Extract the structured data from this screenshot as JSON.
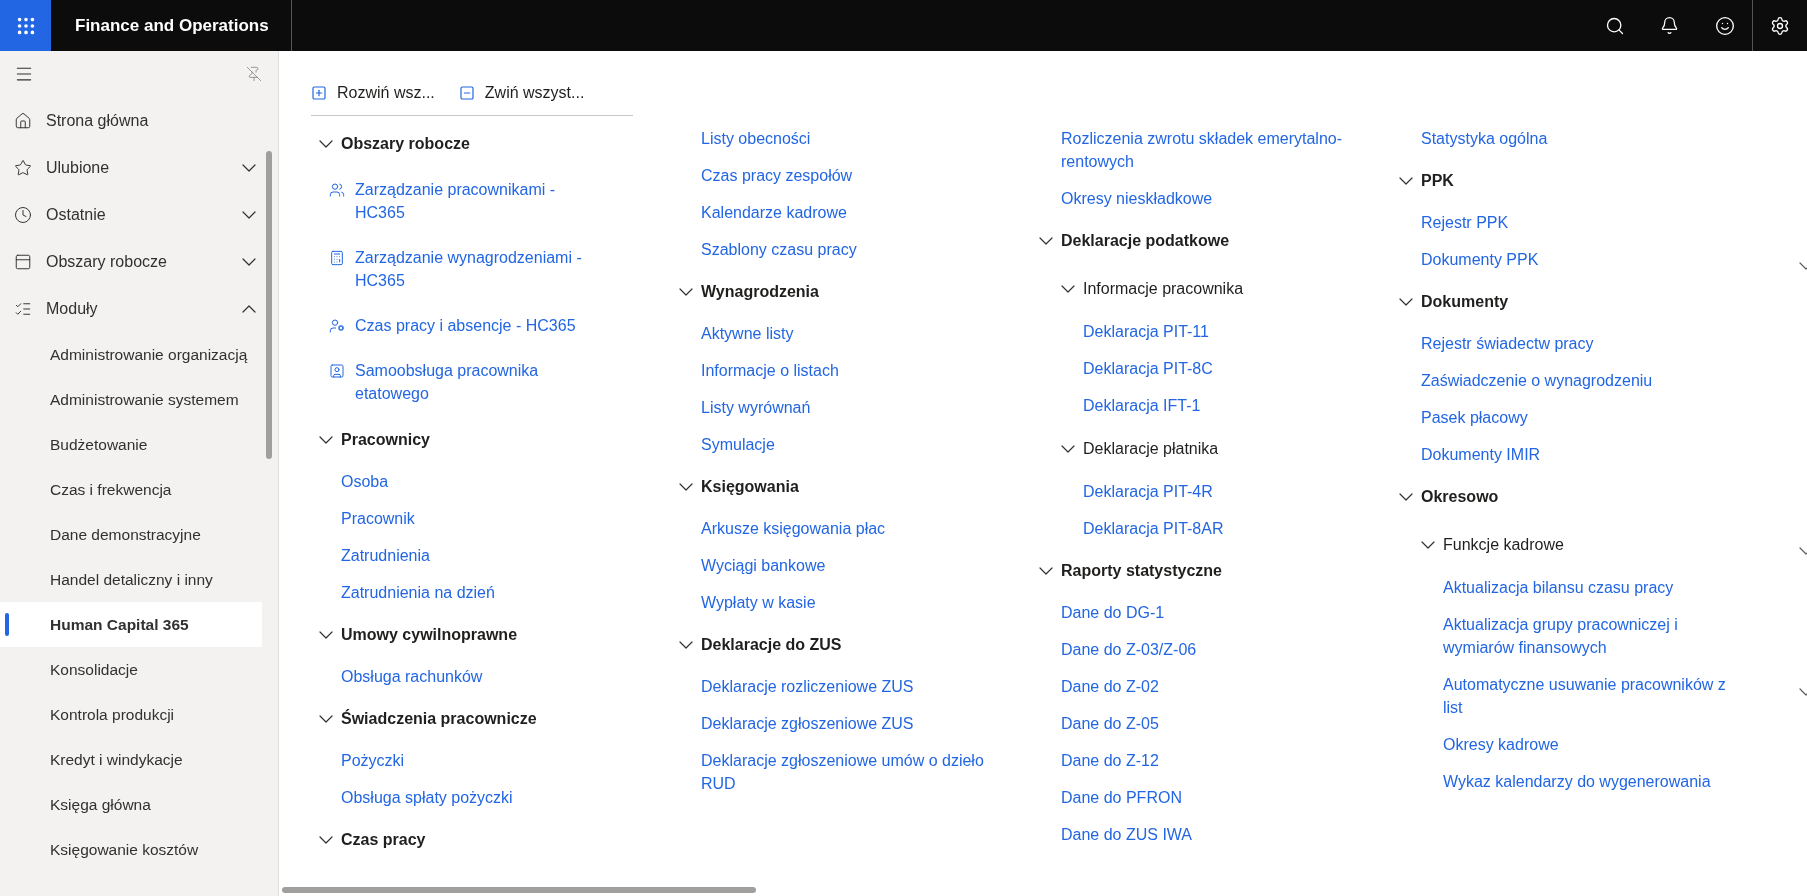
{
  "app": {
    "title": "Finance and Operations"
  },
  "nav": {
    "items": [
      {
        "kind": "link",
        "label": "Strona główna"
      },
      {
        "kind": "section",
        "label": "Ulubione",
        "expanded": false
      },
      {
        "kind": "section",
        "label": "Ostatnie",
        "expanded": false
      },
      {
        "kind": "section",
        "label": "Obszary robocze",
        "expanded": false
      },
      {
        "kind": "section",
        "label": "Moduły",
        "expanded": true
      }
    ],
    "modules": [
      {
        "label": "Administrowanie organizacją",
        "selected": false
      },
      {
        "label": "Administrowanie systemem",
        "selected": false
      },
      {
        "label": "Budżetowanie",
        "selected": false
      },
      {
        "label": "Czas i frekwencja",
        "selected": false
      },
      {
        "label": "Dane demonstracyjne",
        "selected": false
      },
      {
        "label": "Handel detaliczny i inny",
        "selected": false
      },
      {
        "label": "Human Capital 365",
        "selected": true
      },
      {
        "label": "Konsolidacje",
        "selected": false
      },
      {
        "label": "Kontrola produkcji",
        "selected": false
      },
      {
        "label": "Kredyt i windykacje",
        "selected": false
      },
      {
        "label": "Księga główna",
        "selected": false
      },
      {
        "label": "Księgowanie kosztów",
        "selected": false
      }
    ]
  },
  "toolbar": [
    {
      "kind": "expand",
      "label": "Rozwiń wsz..."
    },
    {
      "kind": "collapse",
      "label": "Zwiń wszyst..."
    }
  ],
  "columns": [
    [
      {
        "kind": "group",
        "label": "Obszary robocze",
        "expanded": true,
        "children": [
          {
            "kind": "workspace",
            "label": "Zarządzanie pracownikami - HC365"
          },
          {
            "kind": "workspace",
            "label": "Zarządzanie wynagrodzeniami - HC365"
          },
          {
            "kind": "workspace",
            "label": "Czas pracy i absencje - HC365"
          },
          {
            "kind": "workspace",
            "label": "Samoobsługa pracownika etatowego"
          }
        ]
      },
      {
        "kind": "group",
        "label": "Pracownicy",
        "expanded": true,
        "children": [
          {
            "kind": "link",
            "label": "Osoba"
          },
          {
            "kind": "link",
            "label": "Pracownik"
          },
          {
            "kind": "link",
            "label": "Zatrudnienia"
          },
          {
            "kind": "link",
            "label": "Zatrudnienia na dzień"
          }
        ]
      },
      {
        "kind": "group",
        "label": "Umowy cywilnoprawne",
        "expanded": true,
        "children": [
          {
            "kind": "link",
            "label": "Obsługa rachunków"
          }
        ]
      },
      {
        "kind": "group",
        "label": "Świadczenia pracownicze",
        "expanded": true,
        "children": [
          {
            "kind": "link",
            "label": "Pożyczki"
          },
          {
            "kind": "link",
            "label": "Obsługa spłaty pożyczki"
          }
        ]
      },
      {
        "kind": "group",
        "label": "Czas pracy",
        "expanded": true
      }
    ],
    [
      {
        "kind": "continued",
        "children": [
          {
            "kind": "link",
            "label": "Listy obecności"
          },
          {
            "kind": "link",
            "label": "Czas pracy zespołów"
          },
          {
            "kind": "link",
            "label": "Kalendarze kadrowe"
          },
          {
            "kind": "link",
            "label": "Szablony czasu pracy"
          }
        ]
      },
      {
        "kind": "group",
        "label": "Wynagrodzenia",
        "expanded": true,
        "children": [
          {
            "kind": "link",
            "label": "Aktywne listy"
          },
          {
            "kind": "link",
            "label": "Informacje o listach"
          },
          {
            "kind": "link",
            "label": "Listy wyrównań"
          },
          {
            "kind": "link",
            "label": "Symulacje"
          }
        ]
      },
      {
        "kind": "group",
        "label": "Księgowania",
        "expanded": true,
        "children": [
          {
            "kind": "link",
            "label": "Arkusze księgowania płac"
          },
          {
            "kind": "link",
            "label": "Wyciągi bankowe"
          },
          {
            "kind": "link",
            "label": "Wypłaty w kasie"
          }
        ]
      },
      {
        "kind": "group",
        "label": "Deklaracje do ZUS",
        "expanded": true,
        "children": [
          {
            "kind": "link",
            "label": "Deklaracje rozliczeniowe ZUS"
          },
          {
            "kind": "link",
            "label": "Deklaracje zgłoszeniowe ZUS"
          },
          {
            "kind": "link",
            "label": "Deklaracje zgłoszeniowe umów o dzieło RUD"
          }
        ]
      }
    ],
    [
      {
        "kind": "continued",
        "children": [
          {
            "kind": "link",
            "label": "Rozliczenia zwrotu składek emerytalno-rentowych"
          },
          {
            "kind": "link",
            "label": "Okresy nieskładkowe"
          }
        ]
      },
      {
        "kind": "group",
        "label": "Deklaracje podatkowe",
        "expanded": true,
        "children": [
          {
            "kind": "group",
            "label": "Informacje pracownika",
            "expanded": true,
            "children": [
              {
                "kind": "link",
                "label": "Deklaracja PIT-11"
              },
              {
                "kind": "link",
                "label": "Deklaracja PIT-8C"
              },
              {
                "kind": "link",
                "label": "Deklaracja IFT-1"
              }
            ]
          },
          {
            "kind": "group",
            "label": "Deklaracje płatnika",
            "expanded": true,
            "children": [
              {
                "kind": "link",
                "label": "Deklaracja PIT-4R"
              },
              {
                "kind": "link",
                "label": "Deklaracja PIT-8AR"
              }
            ]
          }
        ]
      },
      {
        "kind": "group",
        "label": "Raporty statystyczne",
        "expanded": true,
        "children": [
          {
            "kind": "link",
            "label": "Dane do DG-1"
          },
          {
            "kind": "link",
            "label": "Dane do Z-03/Z-06"
          },
          {
            "kind": "link",
            "label": "Dane do Z-02"
          },
          {
            "kind": "link",
            "label": "Dane do Z-05"
          },
          {
            "kind": "link",
            "label": "Dane do Z-12"
          },
          {
            "kind": "link",
            "label": "Dane do PFRON"
          },
          {
            "kind": "link",
            "label": "Dane do ZUS IWA"
          }
        ]
      }
    ],
    [
      {
        "kind": "continued",
        "children": [
          {
            "kind": "link",
            "label": "Statystyka ogólna"
          }
        ]
      },
      {
        "kind": "group",
        "label": "PPK",
        "expanded": true,
        "children": [
          {
            "kind": "link",
            "label": "Rejestr PPK"
          },
          {
            "kind": "link",
            "label": "Dokumenty PPK"
          }
        ]
      },
      {
        "kind": "group",
        "label": "Dokumenty",
        "expanded": true,
        "children": [
          {
            "kind": "link",
            "label": "Rejestr świadectw pracy"
          },
          {
            "kind": "link",
            "label": "Zaświadczenie o wynagrodzeniu"
          },
          {
            "kind": "link",
            "label": "Pasek płacowy"
          },
          {
            "kind": "link",
            "label": "Dokumenty IMIR"
          }
        ]
      },
      {
        "kind": "group",
        "label": "Okresowo",
        "expanded": true,
        "children": [
          {
            "kind": "group",
            "label": "Funkcje kadrowe",
            "expanded": true,
            "children": [
              {
                "kind": "link",
                "label": "Aktualizacja bilansu czasu pracy"
              },
              {
                "kind": "link",
                "label": "Aktualizacja grupy pracowniczej i wymiarów finansowych"
              },
              {
                "kind": "link",
                "label": "Automatyczne usuwanie pracowników z list"
              },
              {
                "kind": "link",
                "label": "Okresy kadrowe"
              },
              {
                "kind": "link",
                "label": "Wykaz kalendarzy do wygenerowania"
              }
            ]
          }
        ]
      }
    ]
  ]
}
